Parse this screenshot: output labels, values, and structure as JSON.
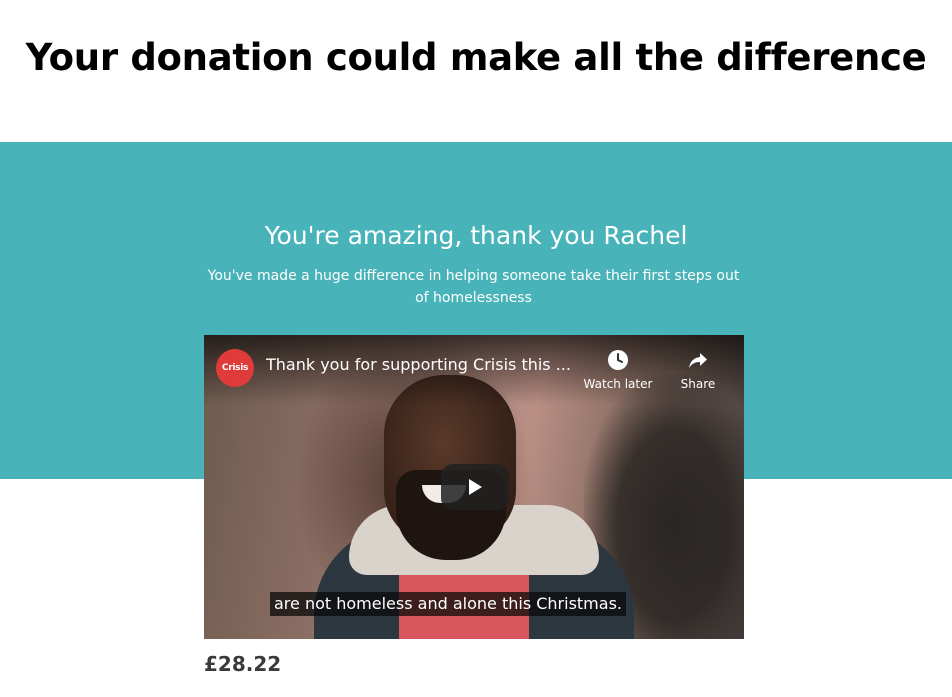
{
  "heading": "Your donation could make all the difference",
  "thanks": {
    "title": "You're amazing, thank you Rachel",
    "subtitle": "You've made a huge difference in helping someone take their first steps out of homelessness"
  },
  "video": {
    "channel_logo_text": "Crisis",
    "title": "Thank you for supporting Crisis this ...",
    "watch_later_label": "Watch later",
    "share_label": "Share",
    "caption": "are not homeless and alone this Christmas.",
    "icons": {
      "watch_later": "clock-icon",
      "share": "share-arrow-icon",
      "play": "play-icon"
    }
  },
  "donation": {
    "amount": "£28.22"
  },
  "colors": {
    "band": "#48b3b8",
    "logo": "#e03b3b"
  }
}
